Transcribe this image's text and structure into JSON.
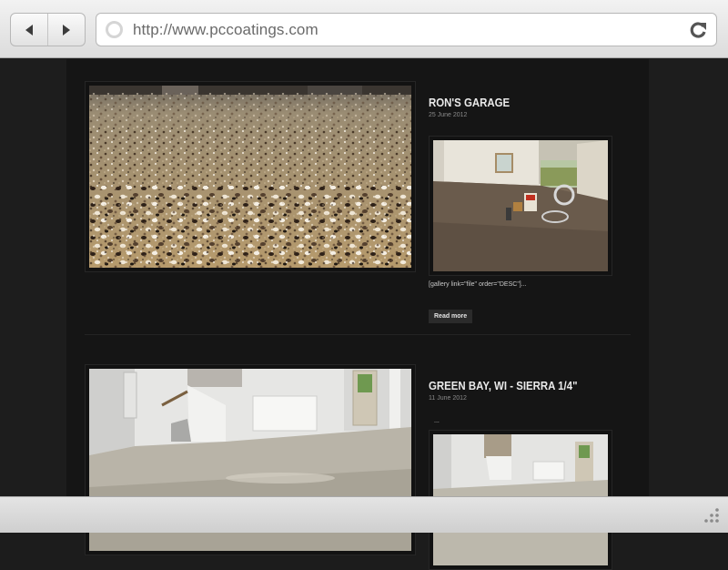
{
  "browser": {
    "url": "http://www.pccoatings.com",
    "back_icon": "back-arrow-icon",
    "forward_icon": "forward-arrow-icon",
    "reload_icon": "reload-icon"
  },
  "posts": [
    {
      "title": "RON'S GARAGE",
      "date": "25 June 2012",
      "excerpt": "[gallery link=\"file\" order=\"DESC\"]...",
      "read_more": "Read more"
    },
    {
      "title": "GREEN BAY, WI - SIERRA 1/4\"",
      "date": "11 June 2012",
      "excerpt": "..."
    }
  ]
}
